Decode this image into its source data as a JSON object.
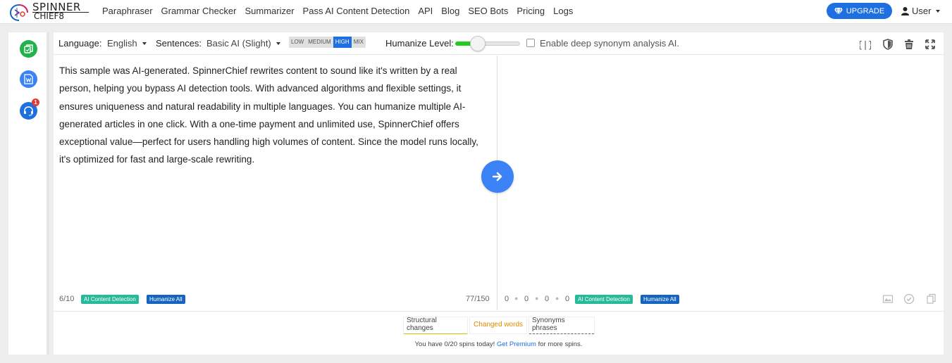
{
  "brand": {
    "line1": "SPINNER",
    "line2": "CHIEF8"
  },
  "nav": {
    "links": [
      "Paraphraser",
      "Grammar Checker",
      "Summarizer",
      "Pass AI Content Detection",
      "API",
      "Blog",
      "SEO Bots",
      "Pricing",
      "Logs"
    ],
    "upgrade_label": "UPGRADE",
    "user_label": "User"
  },
  "rail": {
    "notification_count": "1"
  },
  "toolbar": {
    "language_label": "Language:",
    "language_value": "English",
    "sentences_label": "Sentences:",
    "sentences_value": "Basic AI (Slight)",
    "levels": [
      "LOW",
      "MEDIUM",
      "HIGH",
      "MIX"
    ],
    "active_level": "HIGH",
    "humanize_label": "Humanize Level:",
    "humanize_level": 0.35,
    "deep_synonym_label": "Enable deep synonym analysis AI.",
    "deep_synonym_checked": false
  },
  "input": {
    "text": "This sample was AI-generated. SpinnerChief rewrites content to sound like it's written by a real person, helping you bypass AI detection tools. With advanced algorithms and flexible settings, it ensures uniqueness and natural readability in multiple languages. You can humanize multiple AI-generated articles in one click. With a one-time payment and unlimited use, SpinnerChief offers exceptional value—perfect for users handling high volumes of content. Since the model runs locally, it's optimized for fast and large-scale rewriting.",
    "sentence_count": "6/10",
    "word_count": "77/150",
    "detect_label": "AI Content Detection",
    "humanize_label": "Humanize All"
  },
  "output": {
    "stats": [
      "0",
      "0",
      "0",
      "0"
    ],
    "detect_label": "AI Content Detection",
    "humanize_label": "Humanize All"
  },
  "legend": {
    "structural": "Structural changes",
    "changed": "Changed words",
    "synonyms": "Synonyms phrases"
  },
  "footer": {
    "spins_prefix": "You have 0/20 spins today!",
    "premium_link": "Get Premium",
    "spins_suffix": "for more spins."
  },
  "colors": {
    "primary": "#1e6fe0",
    "green": "#26b99a",
    "slider_fill": "#22cc22",
    "changed_words": "#e08a00",
    "structural_underline": "#d4c000"
  }
}
